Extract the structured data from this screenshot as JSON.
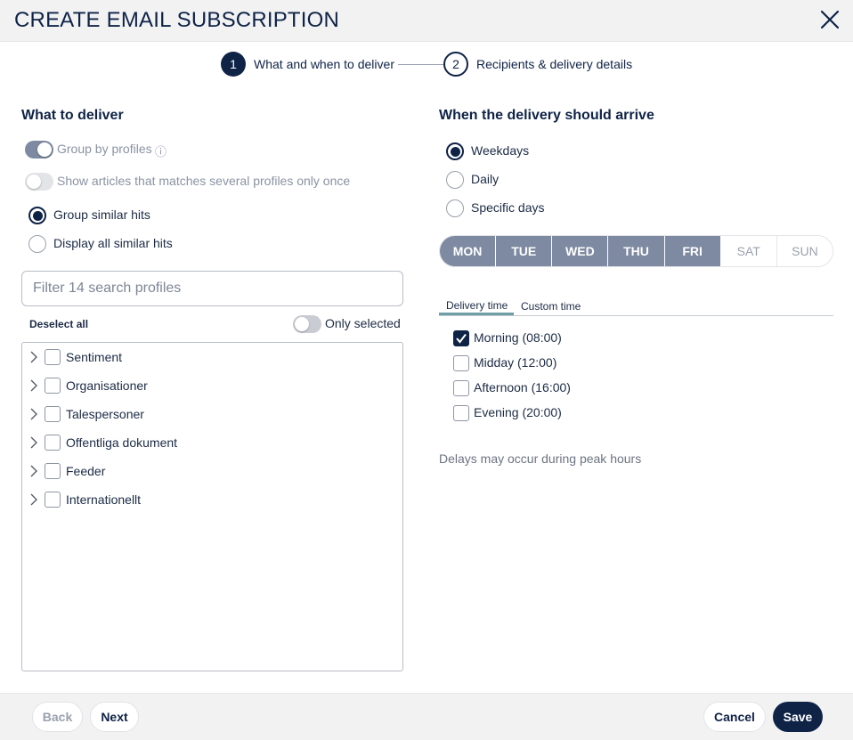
{
  "dialog": {
    "title": "CREATE EMAIL SUBSCRIPTION"
  },
  "stepper": {
    "steps": [
      {
        "number": "1",
        "label": "What and when to deliver"
      },
      {
        "number": "2",
        "label": "Recipients & delivery details"
      }
    ]
  },
  "what": {
    "heading": "What to deliver",
    "group_by_profiles": "Group by profiles",
    "info_icon": "ⓘ",
    "show_once": "Show articles that matches several profiles only once",
    "group_similar": "Group similar hits",
    "display_all": "Display all similar hits",
    "filter_placeholder": "Filter 14 search profiles",
    "deselect_all": "Deselect all",
    "only_selected": "Only selected",
    "profiles": [
      "Sentiment",
      "Organisationer",
      "Talespersoner",
      "Offentliga dokument",
      "Feeder",
      "Internationellt"
    ]
  },
  "when": {
    "heading": "When the delivery should arrive",
    "options": [
      "Weekdays",
      "Daily",
      "Specific days"
    ],
    "days": [
      "MON",
      "TUE",
      "WED",
      "THU",
      "FRI",
      "SAT",
      "SUN"
    ],
    "tab_delivery_time": "Delivery time",
    "tab_custom_time": "Custom time",
    "times": [
      "Morning (08:00)",
      "Midday (12:00)",
      "Afternoon (16:00)",
      "Evening (20:00)"
    ],
    "note": "Delays may occur during peak hours"
  },
  "footer": {
    "back": "Back",
    "next": "Next",
    "cancel": "Cancel",
    "save": "Save"
  },
  "colors": {
    "primary": "#0f2347",
    "selected_day": "#7d8aa1",
    "tab_accent": "#6e9ea5"
  }
}
